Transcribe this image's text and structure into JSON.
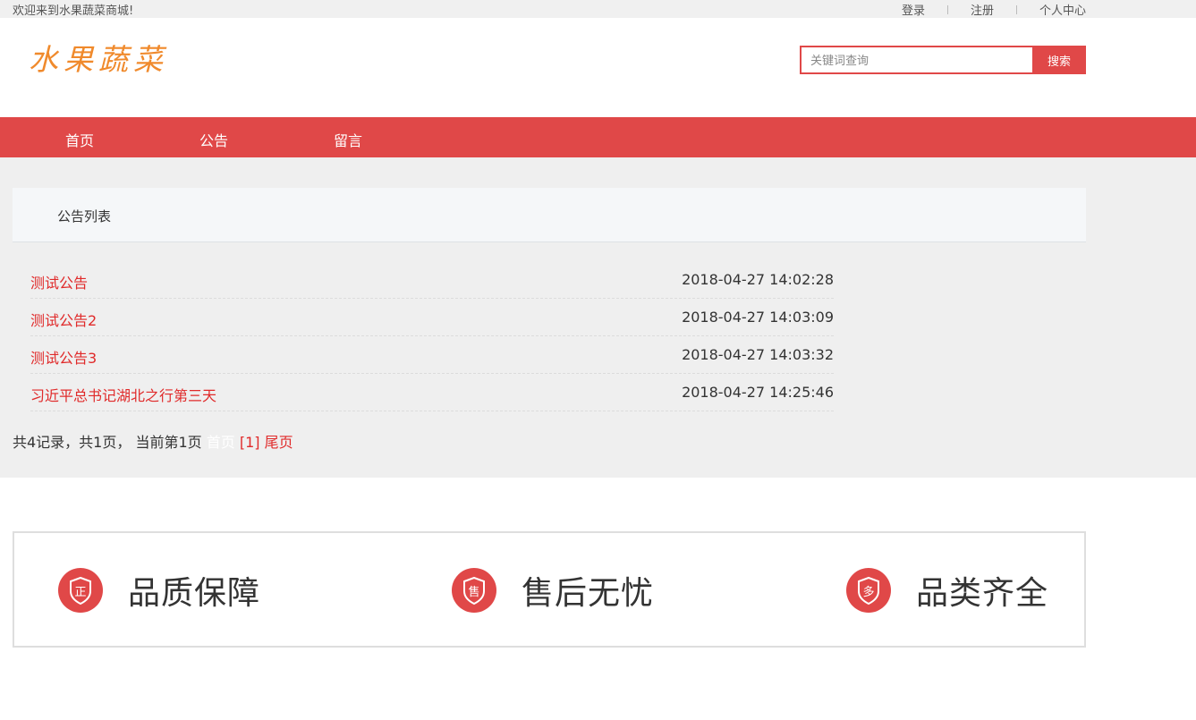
{
  "topbar": {
    "welcome": "欢迎来到水果蔬菜商城!",
    "login": "登录",
    "register": "注册",
    "personal_center": "个人中心"
  },
  "header": {
    "logo": "水果蔬菜",
    "search_placeholder": "关键词查询",
    "search_button": "搜索"
  },
  "nav": {
    "items": [
      "首页",
      "公告",
      "留言"
    ]
  },
  "panel": {
    "title": "公告列表",
    "notices": [
      {
        "title": "测试公告",
        "date": "2018-04-27 14:02:28"
      },
      {
        "title": "测试公告2",
        "date": "2018-04-27 14:03:09"
      },
      {
        "title": "测试公告3",
        "date": "2018-04-27 14:03:32"
      },
      {
        "title": "习近平总书记湖北之行第三天",
        "date": "2018-04-27 14:25:46"
      }
    ],
    "pager": {
      "summary": "共4记录，共1页， 当前第1页",
      "first": "首页",
      "current": "[1]",
      "last": "尾页"
    }
  },
  "features": [
    {
      "label": "品质保障",
      "icon_char": "正",
      "icon": "quality-shield-icon"
    },
    {
      "label": "售后无忧",
      "icon_char": "售",
      "icon": "after-sales-shield-icon"
    },
    {
      "label": "品类齐全",
      "icon_char": "多",
      "icon": "variety-shield-icon"
    }
  ],
  "colors": {
    "accent": "#e04848",
    "link_red": "#e02a2a",
    "logo_orange": "#f08a2c"
  }
}
